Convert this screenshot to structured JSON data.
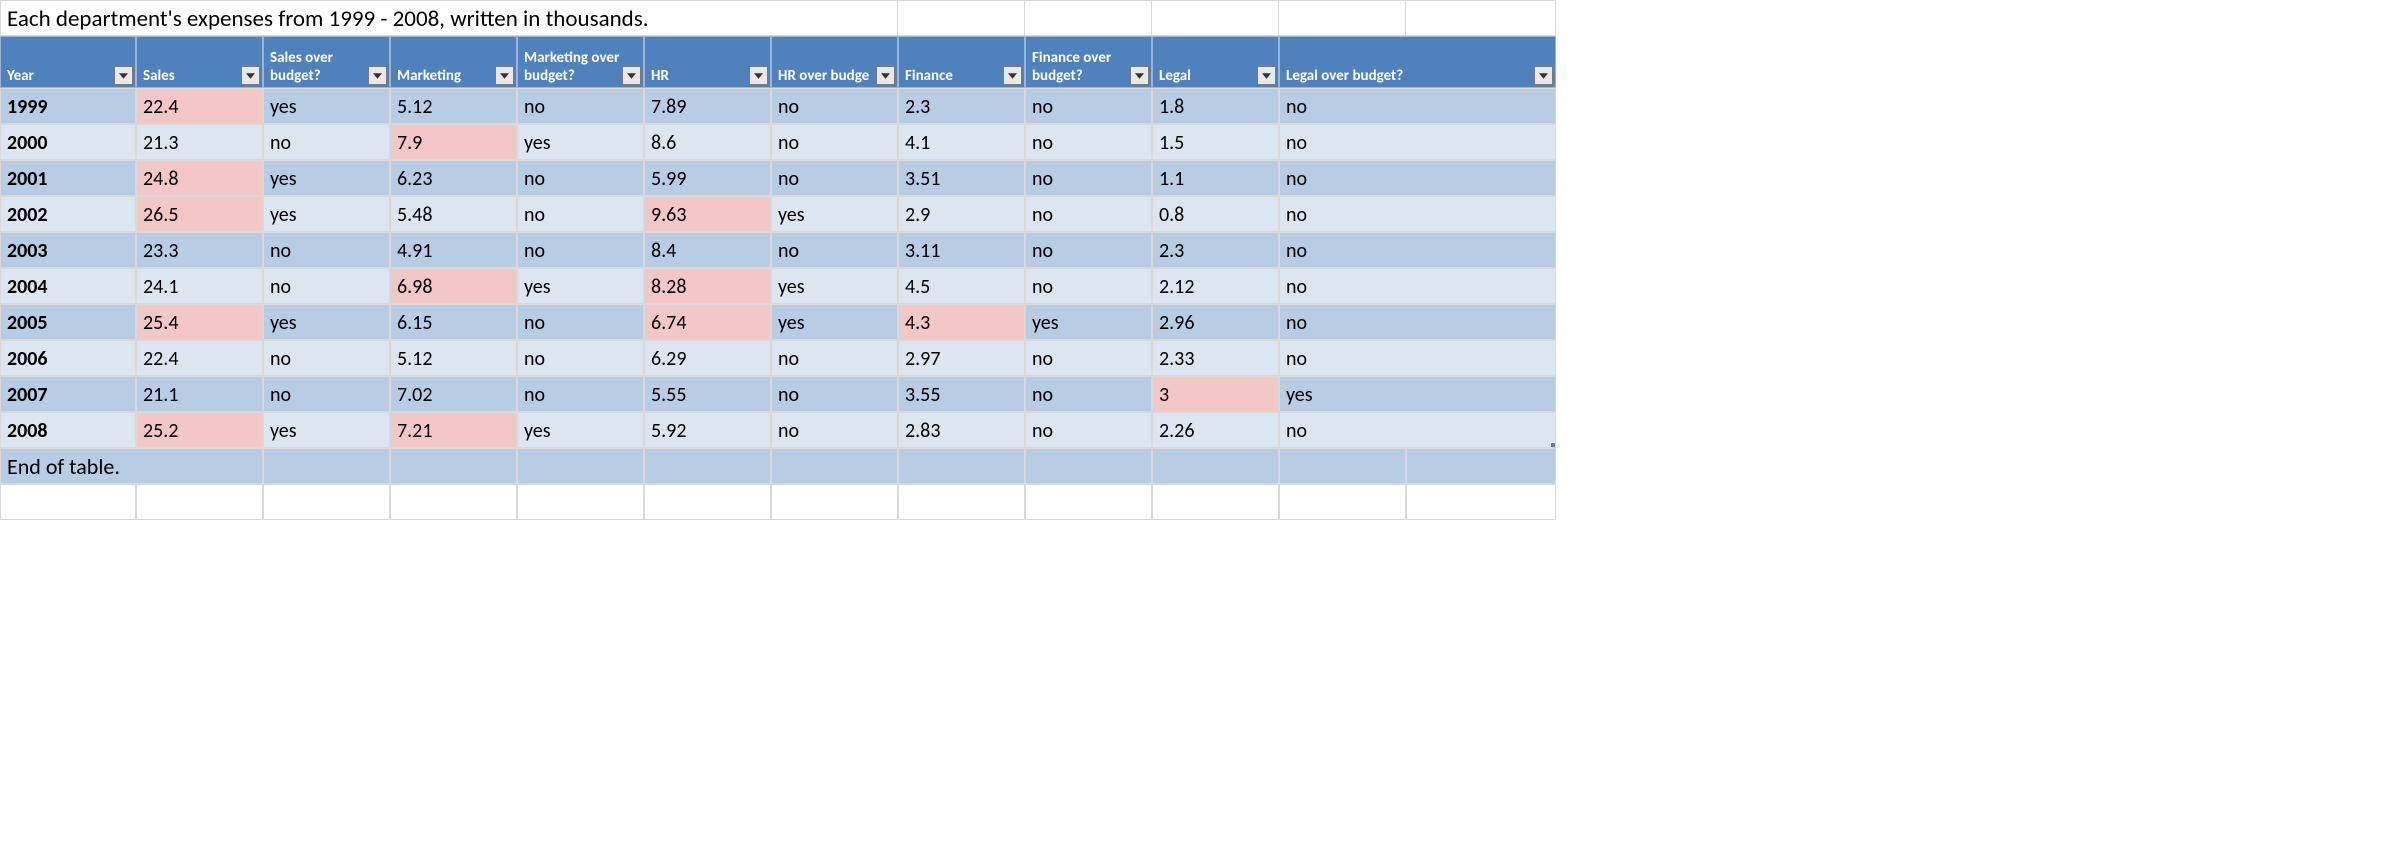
{
  "title": "Each department's expenses from 1999 - 2008, written in thousands.",
  "footer": "End of table.",
  "columns": [
    "Year",
    "Sales",
    "Sales over budget?",
    "Marketing",
    "Marketing over budget?",
    "HR",
    "HR over budget?",
    "Finance",
    "Finance over budget?",
    "Legal",
    "Legal over budget?"
  ],
  "column_truncated_6": "HR over budge",
  "rows": [
    {
      "year": "1999",
      "sales": "22.4",
      "sales_ob": "yes",
      "mkt": "5.12",
      "mkt_ob": "no",
      "hr": "7.89",
      "hr_ob": "no",
      "fin": "2.3",
      "fin_ob": "no",
      "legal": "1.8",
      "legal_ob": "no",
      "hl": {
        "sales": true
      }
    },
    {
      "year": "2000",
      "sales": "21.3",
      "sales_ob": "no",
      "mkt": "7.9",
      "mkt_ob": "yes",
      "hr": "8.6",
      "hr_ob": "no",
      "fin": "4.1",
      "fin_ob": "no",
      "legal": "1.5",
      "legal_ob": "no",
      "hl": {
        "mkt": true
      }
    },
    {
      "year": "2001",
      "sales": "24.8",
      "sales_ob": "yes",
      "mkt": "6.23",
      "mkt_ob": "no",
      "hr": "5.99",
      "hr_ob": "no",
      "fin": "3.51",
      "fin_ob": "no",
      "legal": "1.1",
      "legal_ob": "no",
      "hl": {
        "sales": true
      }
    },
    {
      "year": "2002",
      "sales": "26.5",
      "sales_ob": "yes",
      "mkt": "5.48",
      "mkt_ob": "no",
      "hr": "9.63",
      "hr_ob": "yes",
      "fin": "2.9",
      "fin_ob": "no",
      "legal": "0.8",
      "legal_ob": "no",
      "hl": {
        "sales": true,
        "hr": true
      }
    },
    {
      "year": "2003",
      "sales": "23.3",
      "sales_ob": "no",
      "mkt": "4.91",
      "mkt_ob": "no",
      "hr": "8.4",
      "hr_ob": "no",
      "fin": "3.11",
      "fin_ob": "no",
      "legal": "2.3",
      "legal_ob": "no",
      "hl": {}
    },
    {
      "year": "2004",
      "sales": "24.1",
      "sales_ob": "no",
      "mkt": "6.98",
      "mkt_ob": "yes",
      "hr": "8.28",
      "hr_ob": "yes",
      "fin": "4.5",
      "fin_ob": "no",
      "legal": "2.12",
      "legal_ob": "no",
      "hl": {
        "mkt": true,
        "hr": true
      }
    },
    {
      "year": "2005",
      "sales": "25.4",
      "sales_ob": "yes",
      "mkt": "6.15",
      "mkt_ob": "no",
      "hr": "6.74",
      "hr_ob": "yes",
      "fin": "4.3",
      "fin_ob": "yes",
      "legal": "2.96",
      "legal_ob": "no",
      "hl": {
        "sales": true,
        "hr": true,
        "fin": true
      }
    },
    {
      "year": "2006",
      "sales": "22.4",
      "sales_ob": "no",
      "mkt": "5.12",
      "mkt_ob": "no",
      "hr": "6.29",
      "hr_ob": "no",
      "fin": "2.97",
      "fin_ob": "no",
      "legal": "2.33",
      "legal_ob": "no",
      "hl": {}
    },
    {
      "year": "2007",
      "sales": "21.1",
      "sales_ob": "no",
      "mkt": "7.02",
      "mkt_ob": "no",
      "hr": "5.55",
      "hr_ob": "no",
      "fin": "3.55",
      "fin_ob": "no",
      "legal": "3",
      "legal_ob": "yes",
      "hl": {
        "legal": true
      }
    },
    {
      "year": "2008",
      "sales": "25.2",
      "sales_ob": "yes",
      "mkt": "7.21",
      "mkt_ob": "yes",
      "hr": "5.92",
      "hr_ob": "no",
      "fin": "2.83",
      "fin_ob": "no",
      "legal": "2.26",
      "legal_ob": "no",
      "hl": {
        "sales": true,
        "mkt": true
      }
    }
  ],
  "colors": {
    "header_bg": "#4f81bd",
    "band_a": "#b8cce4",
    "band_b": "#dce6f1",
    "highlight": "#f4c7c7"
  },
  "chart_data": {
    "type": "table",
    "title": "Each department's expenses from 1999 - 2008, written in thousands.",
    "columns": [
      "Year",
      "Sales",
      "Sales over budget?",
      "Marketing",
      "Marketing over budget?",
      "HR",
      "HR over budget?",
      "Finance",
      "Finance over budget?",
      "Legal",
      "Legal over budget?"
    ],
    "rows": [
      [
        "1999",
        22.4,
        "yes",
        5.12,
        "no",
        7.89,
        "no",
        2.3,
        "no",
        1.8,
        "no"
      ],
      [
        "2000",
        21.3,
        "no",
        7.9,
        "yes",
        8.6,
        "no",
        4.1,
        "no",
        1.5,
        "no"
      ],
      [
        "2001",
        24.8,
        "yes",
        6.23,
        "no",
        5.99,
        "no",
        3.51,
        "no",
        1.1,
        "no"
      ],
      [
        "2002",
        26.5,
        "yes",
        5.48,
        "no",
        9.63,
        "yes",
        2.9,
        "no",
        0.8,
        "no"
      ],
      [
        "2003",
        23.3,
        "no",
        4.91,
        "no",
        8.4,
        "no",
        3.11,
        "no",
        2.3,
        "no"
      ],
      [
        "2004",
        24.1,
        "no",
        6.98,
        "yes",
        8.28,
        "yes",
        4.5,
        "no",
        2.12,
        "no"
      ],
      [
        "2005",
        25.4,
        "yes",
        6.15,
        "no",
        6.74,
        "yes",
        4.3,
        "yes",
        2.96,
        "no"
      ],
      [
        "2006",
        22.4,
        "no",
        5.12,
        "no",
        6.29,
        "no",
        2.97,
        "no",
        2.33,
        "no"
      ],
      [
        "2007",
        21.1,
        "no",
        7.02,
        "no",
        5.55,
        "no",
        3.55,
        "no",
        3,
        "yes"
      ],
      [
        "2008",
        25.2,
        "yes",
        7.21,
        "yes",
        5.92,
        "no",
        2.83,
        "no",
        2.26,
        "no"
      ]
    ]
  }
}
